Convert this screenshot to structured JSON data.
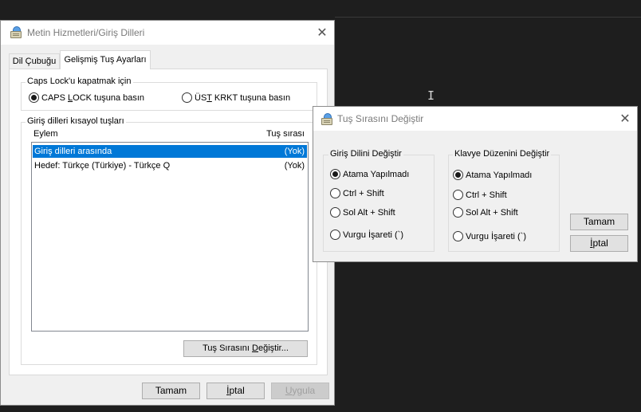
{
  "main_dialog": {
    "title": "Metin Hizmetleri/Giriş Dilleri",
    "tabs": [
      {
        "label": "Dil Çubuğu"
      },
      {
        "label": "Gelişmiş Tuş Ayarları"
      }
    ],
    "caps_group": {
      "label": "Caps Lock'u kapatmak için",
      "options": [
        {
          "label_pre": "CAPS ",
          "label_u": "L",
          "label_post": "OCK tuşuna basın",
          "checked": true
        },
        {
          "label_pre": "ÜS",
          "label_u": "T",
          "label_post": " KRKT tuşuna basın",
          "checked": false
        }
      ]
    },
    "hotkeys_group": {
      "label": "Giriş dilleri kısayol tuşları",
      "col_action": "Eylem",
      "col_keys": "Tuş sırası",
      "rows": [
        {
          "action": "Giriş dilleri arasında",
          "keys": "(Yok)",
          "selected": true
        },
        {
          "action": "Hedef: Türkçe (Türkiye) - Türkçe Q",
          "keys": "(Yok)",
          "selected": false
        }
      ],
      "change_button": {
        "pre": "Tuş Sırasını ",
        "u": "D",
        "post": "eğiştir..."
      }
    },
    "buttons": {
      "ok": "Tamam",
      "cancel_u": "İ",
      "cancel_post": "ptal",
      "apply_u": "U",
      "apply_post": "ygula"
    }
  },
  "change_dialog": {
    "title": "Tuş Sırasını Değiştir",
    "input_group": {
      "label": "Giriş Dilini Değiştir",
      "options": [
        {
          "label": "Atama Yapılmadı",
          "checked": true
        },
        {
          "label": "Ctrl + Shift",
          "checked": false
        },
        {
          "label": "Sol Alt + Shift",
          "checked": false
        },
        {
          "label": "Vurgu İşareti (`)",
          "checked": false
        }
      ]
    },
    "layout_group": {
      "label": "Klavye Düzenini Değiştir",
      "options": [
        {
          "label": "Atama Yapılmadı",
          "checked": true
        },
        {
          "label": "Ctrl + Shift",
          "checked": false
        },
        {
          "label": "Sol Alt + Shift",
          "checked": false
        },
        {
          "label": "Vurgu İşareti (`)",
          "checked": false
        }
      ]
    },
    "buttons": {
      "ok": "Tamam",
      "cancel_u": "İ",
      "cancel_post": "ptal"
    }
  },
  "colors": {
    "desktop": "#1e1e1e",
    "dialog_bg": "#f0f0f0",
    "selection": "#0078d7"
  }
}
